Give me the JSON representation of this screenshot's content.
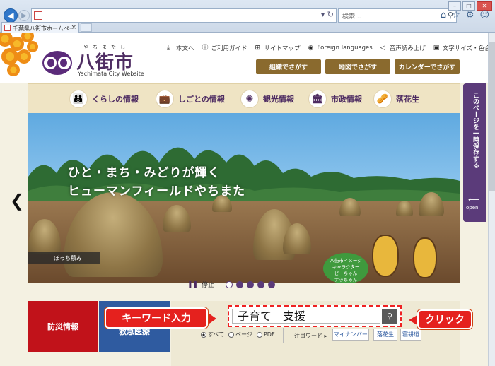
{
  "browser": {
    "tab_title": "千葉県八街市ホームペー...",
    "search_placeholder": "検索...",
    "search_icon": "search-icon",
    "back_icon": "back-arrow-icon",
    "forward_icon": "forward-arrow-icon"
  },
  "site": {
    "logo_ruby": "やちまたし",
    "logo_text": "八街市",
    "logo_sub": "Yachimata City Website",
    "util_nav": [
      {
        "icon": "arrow-down-icon",
        "glyph": "⤓",
        "label": "本文へ"
      },
      {
        "icon": "info-icon",
        "glyph": "ⓘ",
        "label": "ご利用ガイド"
      },
      {
        "icon": "sitemap-icon",
        "glyph": "⊞",
        "label": "サイトマップ"
      },
      {
        "icon": "globe-icon",
        "glyph": "◉",
        "label": "Foreign languages"
      },
      {
        "icon": "speaker-icon",
        "glyph": "◁",
        "label": "音声読み上げ"
      },
      {
        "icon": "text-size-icon",
        "glyph": "▣",
        "label": "文字サイズ・色合い変更"
      }
    ],
    "actions": [
      "組織でさがす",
      "地図でさがす",
      "カレンダーでさがす"
    ],
    "categories": [
      {
        "label": "くらしの情報",
        "icon": "family-icon",
        "glyph": "👪"
      },
      {
        "label": "しごとの情報",
        "icon": "briefcase-icon",
        "glyph": "💼"
      },
      {
        "label": "観光情報",
        "icon": "sunflower-icon",
        "glyph": "✺"
      },
      {
        "label": "市政情報",
        "icon": "city-hall-icon",
        "glyph": "🏛"
      },
      {
        "label": "落花生",
        "icon": "peanut-icon",
        "glyph": "🥜"
      }
    ]
  },
  "hero": {
    "title_line1": "ひと・まち・みどりが輝く",
    "title_line2": "ヒューマンフィールドやちまた",
    "caption": "ぼっち積み",
    "character_bubble_1": "八街市イメージ",
    "character_bubble_2": "キャラクター",
    "character_bubble_3": "ピーちゃん",
    "character_bubble_4": "ナッちゃん",
    "pause_label": "停止",
    "slide_count": 5,
    "active_slide": 1
  },
  "sidetab": {
    "text": "このページを一時保存する",
    "open_label": "open"
  },
  "bottom": {
    "bosai_label": "防災情報",
    "kyukyu_label": "救急医療",
    "search_value": "子育て　支援",
    "radio_options": [
      "すべて",
      "ページ",
      "PDF"
    ],
    "selected_radio": "すべて",
    "keywords_label": "注目ワード",
    "keywords": [
      "マイナンバー",
      "落花生",
      "寝耕道"
    ]
  },
  "annotations": {
    "left_callout": "キーワード入力",
    "right_callout": "クリック"
  },
  "colors": {
    "brand_purple": "#4e2c62",
    "action_brown": "#8a6a2e",
    "bosai_red": "#c1121a",
    "kyukyu_blue": "#2f5ba0",
    "callout_red": "#e5211e"
  }
}
